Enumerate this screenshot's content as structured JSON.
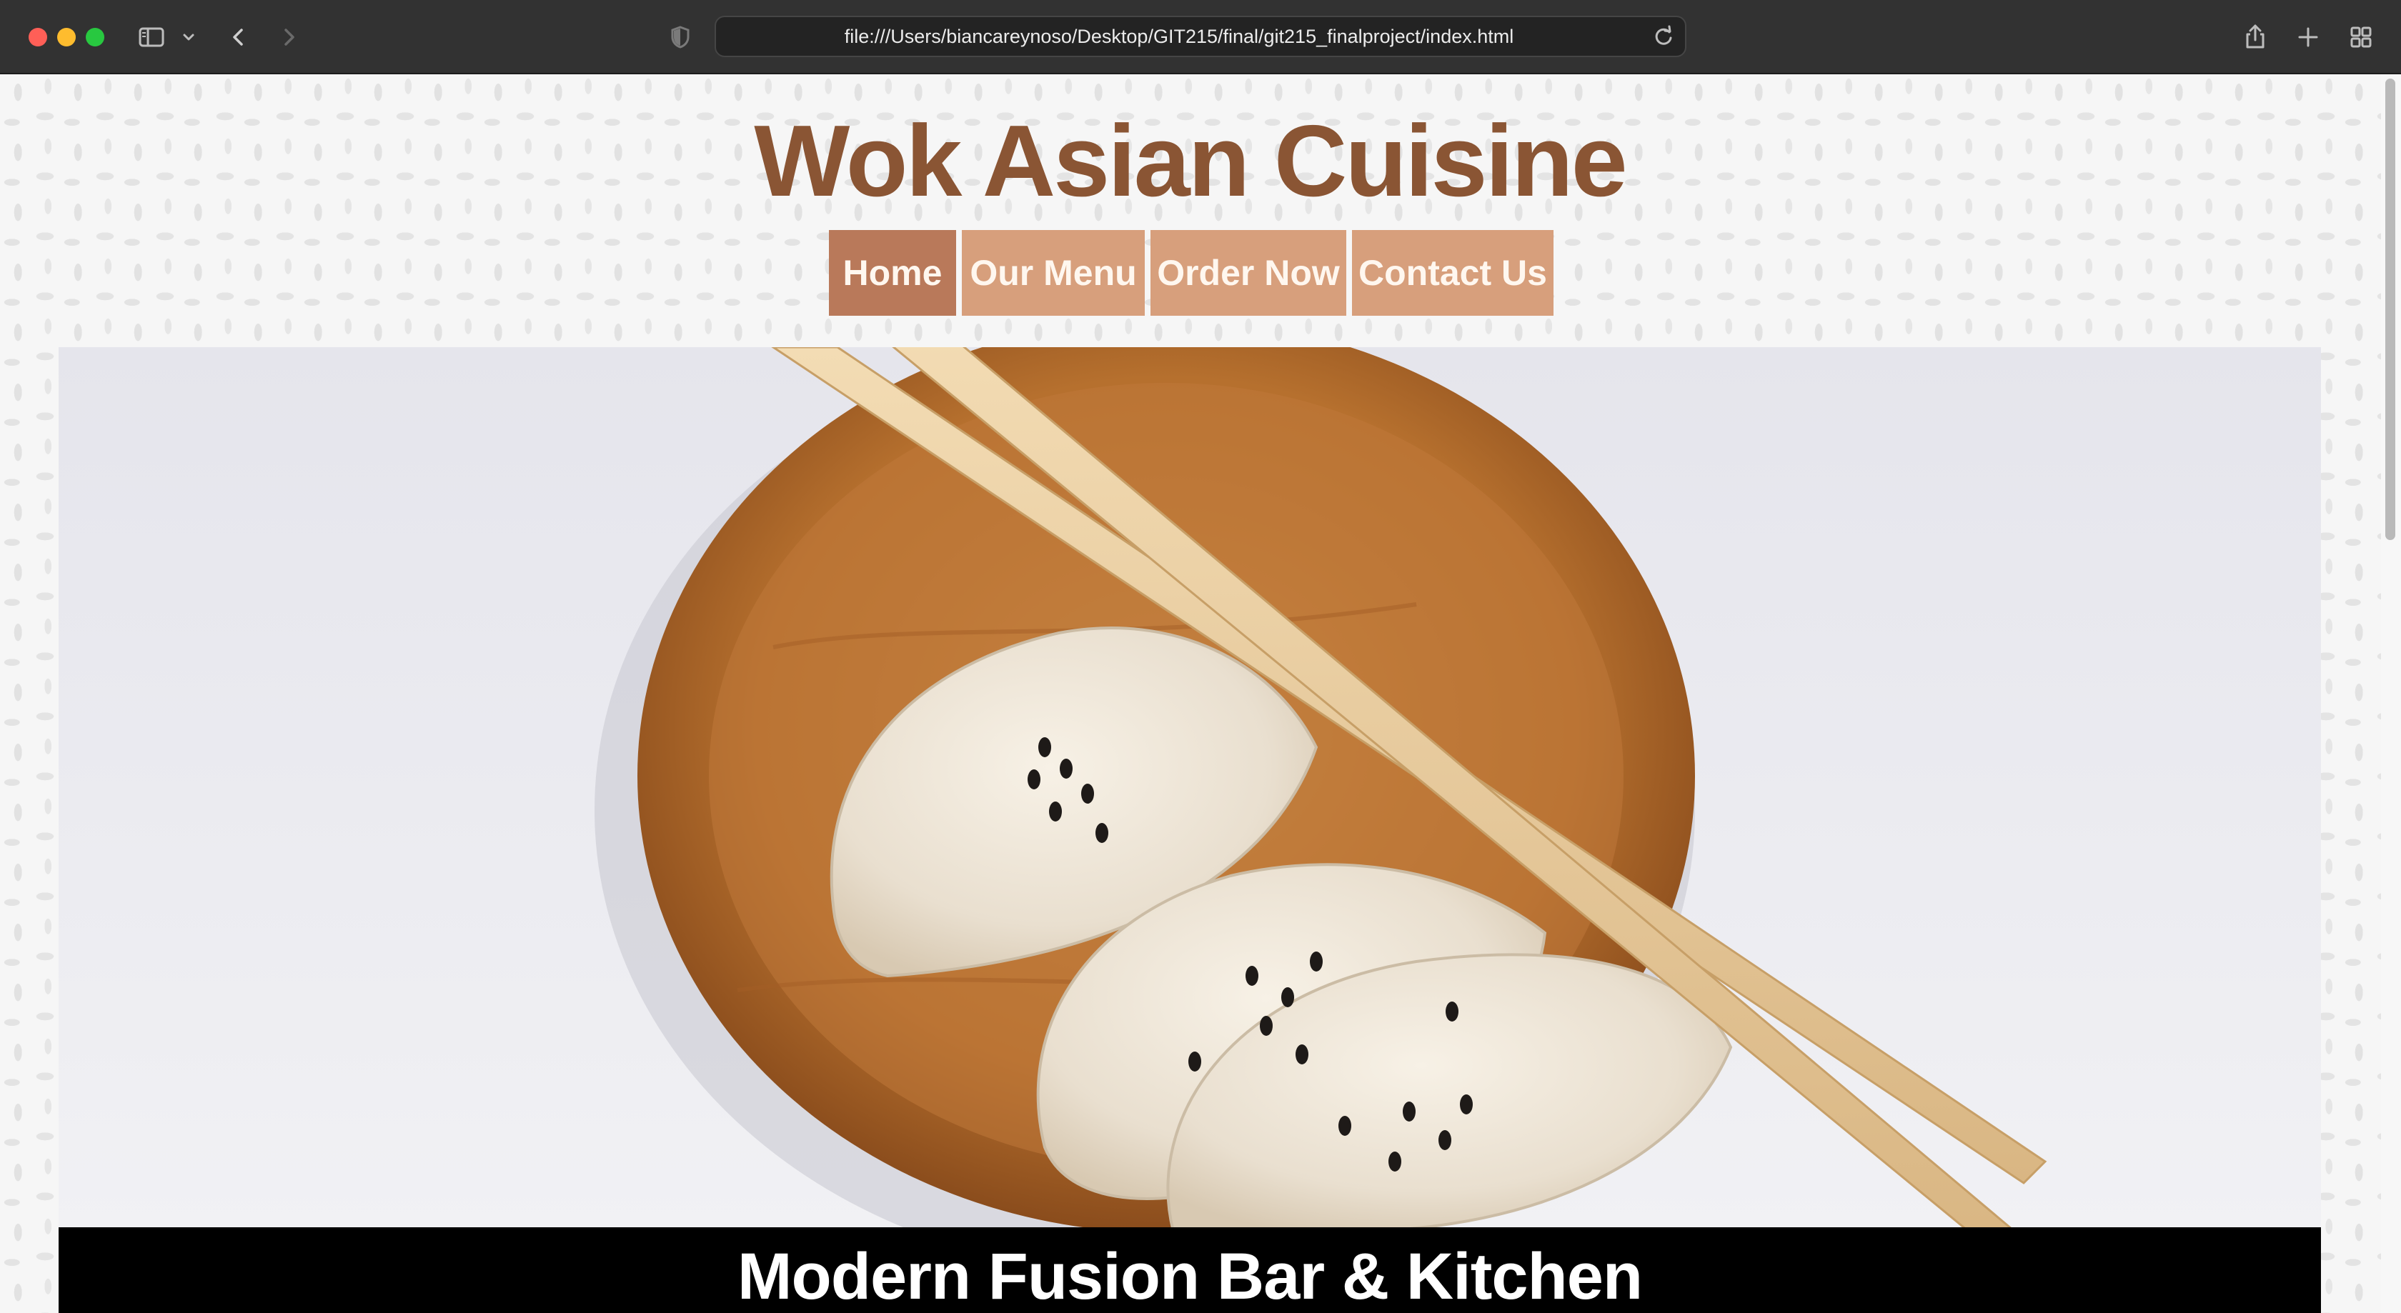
{
  "browser": {
    "url": "file:///Users/biancareynoso/Desktop/GIT215/final/git215_finalproject/index.html",
    "icons": {
      "sidebar": "sidebar-icon",
      "back": "chevron-left-icon",
      "forward": "chevron-right-icon",
      "privacy": "shield-icon",
      "reload": "reload-icon",
      "share": "share-icon",
      "new_tab": "plus-icon",
      "tab_overview": "grid-icon"
    }
  },
  "site": {
    "title": "Wok Asian Cuisine",
    "nav": [
      {
        "label": "Home",
        "active": true
      },
      {
        "label": "Our Menu",
        "active": false
      },
      {
        "label": "Order Now",
        "active": false
      },
      {
        "label": "Contact Us",
        "active": false
      }
    ],
    "tagline": "Modern Fusion Bar & Kitchen"
  },
  "colors": {
    "title": "#8a5534",
    "nav_bg": "#d79f7c",
    "nav_active_bg": "#b9795a",
    "tagline_bg": "#000000",
    "tagline_text": "#ffffff"
  }
}
